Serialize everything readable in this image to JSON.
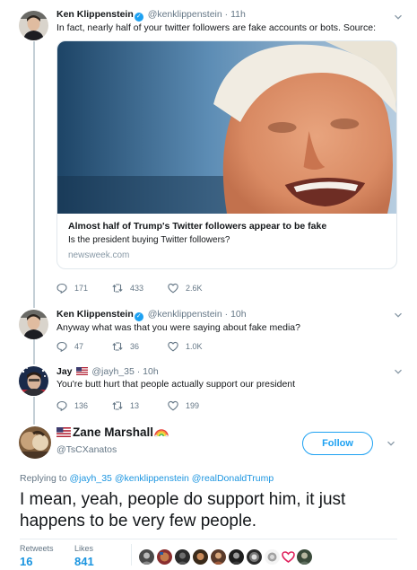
{
  "tweets": [
    {
      "name": "Ken Klippenstein",
      "handle": "@kenklippenstein",
      "time": "11h",
      "text": "In fact, nearly half of your twitter followers are fake accounts or bots. Source:",
      "card": {
        "title": "Almost half of Trump's Twitter followers appear to be fake",
        "description": "Is the president buying Twitter followers?",
        "domain": "newsweek.com"
      },
      "replies": "171",
      "retweets": "433",
      "likes": "2.6K"
    },
    {
      "name": "Ken Klippenstein",
      "handle": "@kenklippenstein",
      "time": "10h",
      "text": "Anyway what was that you were saying about fake media?",
      "replies": "47",
      "retweets": "36",
      "likes": "1.0K"
    },
    {
      "name": "Jay",
      "handle": "@jayh_35",
      "time": "10h",
      "text": "You're butt hurt that people actually support our president",
      "replies": "136",
      "retweets": "13",
      "likes": "199"
    }
  ],
  "focused": {
    "name": "Zane Marshall",
    "handle": "@TsCXanatos",
    "follow_label": "Follow",
    "replying_prefix": "Replying to",
    "mentions": [
      "@jayh_35",
      "@kenklippenstein",
      "@realDonaldTrump"
    ],
    "text": "I mean, yeah, people do support him, it just happens to be very few people.",
    "retweets_label": "Retweets",
    "retweets_count": "16",
    "likes_label": "Likes",
    "likes_count": "841"
  },
  "sep": " · ",
  "colors": {
    "accent": "#1da1f2",
    "link": "#1b95e0",
    "muted": "#657786",
    "border": "#e1e8ed"
  },
  "icons": [
    "verified-badge-icon",
    "us-flag-icon",
    "rainbow-icon",
    "chevron-down-icon",
    "reply-icon",
    "retweet-icon",
    "like-icon"
  ]
}
